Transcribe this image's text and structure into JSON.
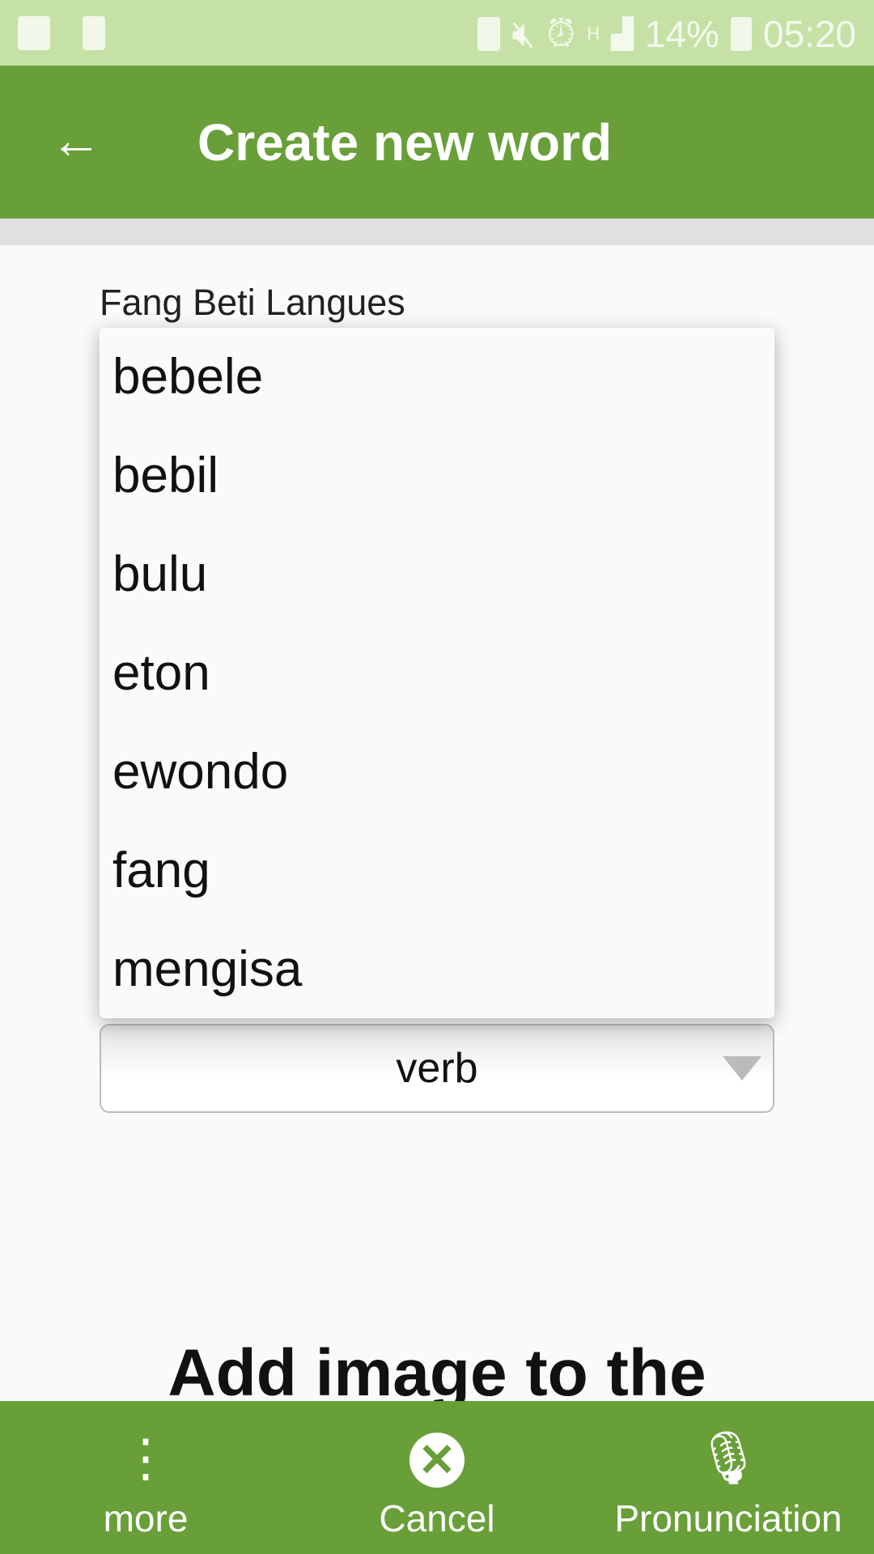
{
  "status_bar": {
    "battery": "14%",
    "time": "05:20",
    "icons": [
      "image-icon",
      "battery-alert-icon",
      "battery-saver-icon",
      "mute-icon",
      "alarm-icon",
      "hspa-icon",
      "signal-icon",
      "battery-icon"
    ]
  },
  "app_bar": {
    "title": "Create new word",
    "back_icon": "arrow-back-icon"
  },
  "form": {
    "language_label": "Fang Beti Langues",
    "type_value": "verb",
    "add_image_heading": "Add image to the"
  },
  "dropdown": {
    "items": [
      "bebele",
      "bebil",
      "bulu",
      "eton",
      "ewondo",
      "fang",
      "mengisa"
    ]
  },
  "bottom_bar": {
    "more": "more",
    "cancel": "Cancel",
    "pronunciation": "Pronunciation"
  },
  "colors": {
    "primary": "#689f38",
    "status": "#c5e1a5"
  }
}
